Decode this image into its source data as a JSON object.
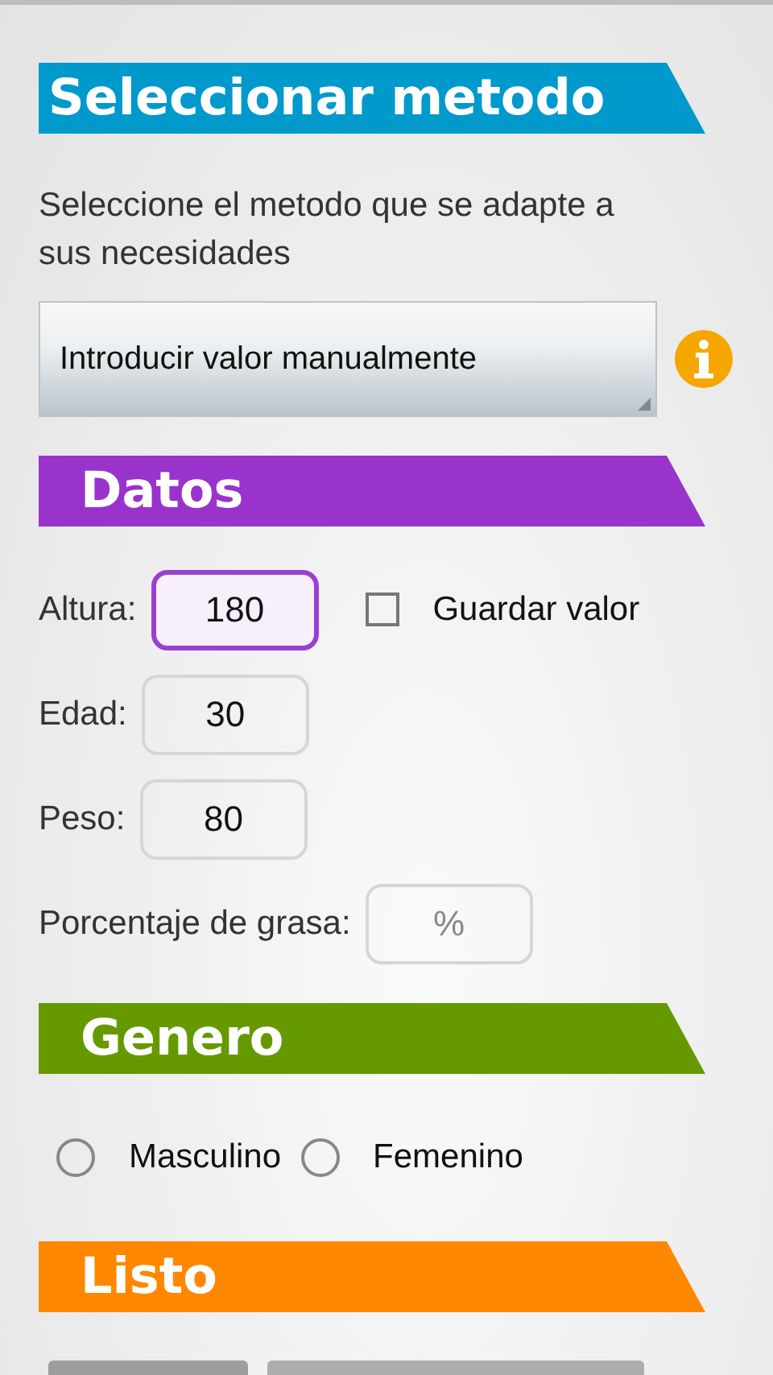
{
  "sections": [
    {
      "title": "Seleccionar metodo",
      "color": "#0099cc",
      "kind": "method",
      "description": "Seleccione el metodo que se adapte a sus necesidades",
      "dropdown": {
        "value": "Introducir valor manualmente"
      }
    },
    {
      "title": "Datos",
      "color": "#9933cc",
      "kind": "data",
      "fields": [
        {
          "label": "Altura:",
          "value": "180",
          "focused": true,
          "checkbox": {
            "label": "Guardar valor",
            "checked": false
          }
        },
        {
          "label": "Edad:",
          "value": "30",
          "focused": false
        },
        {
          "label": "Peso:",
          "value": "80",
          "focused": false
        },
        {
          "label": "Porcentaje de grasa:",
          "placeholder": "%",
          "focused": false
        }
      ]
    },
    {
      "title": "Genero",
      "color": "#669900",
      "kind": "gender",
      "options": [
        {
          "label": "Masculino",
          "selected": false
        },
        {
          "label": "Femenino",
          "selected": false
        }
      ]
    },
    {
      "title": "Listo",
      "color": "#ff8800",
      "kind": "done"
    }
  ]
}
